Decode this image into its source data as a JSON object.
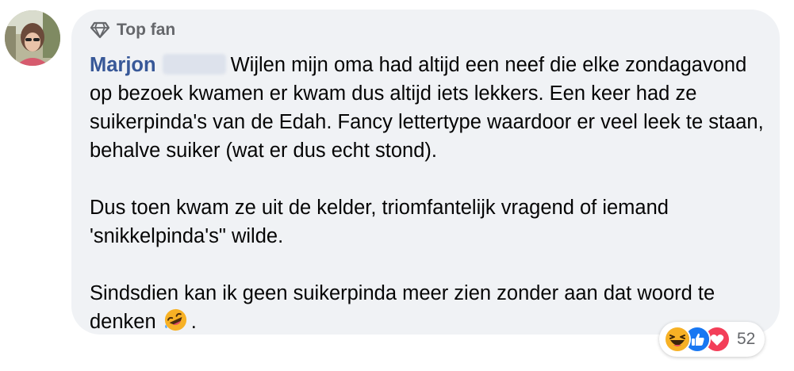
{
  "badge": {
    "icon": "diamond-icon",
    "label": "Top fan"
  },
  "comment": {
    "author_first_name": "Marjon",
    "author_last_name_redacted": true,
    "paragraphs": [
      "Wijlen mijn oma had altijd een neef die elke zondagavond op bezoek kwamen er kwam dus altijd iets lekkers. Een keer had ze suikerpinda's van de Edah. Fancy lettertype waardoor er veel leek te staan, behalve suiker (wat er dus echt stond).",
      "Dus toen kwam ze uit de kelder, triomfantelijk vragend of iemand 'snikkelpinda's\" wilde.",
      "Sindsdien kan ik geen suikerpinda meer zien zonder aan dat woord te denken"
    ],
    "trailing_emoji": "rolling-on-floor-laughing-emoji",
    "trailing_punctuation": "."
  },
  "reactions": {
    "icons": [
      "haha-reaction-icon",
      "like-reaction-icon",
      "love-reaction-icon"
    ],
    "count": "52"
  },
  "colors": {
    "bubble_bg": "#f0f2f5",
    "author_link": "#385898",
    "text": "#050505",
    "secondary_text": "#65676b",
    "like_blue": "#1877f2",
    "love_red": "#f33e58",
    "haha_yellow": "#f7b125"
  }
}
